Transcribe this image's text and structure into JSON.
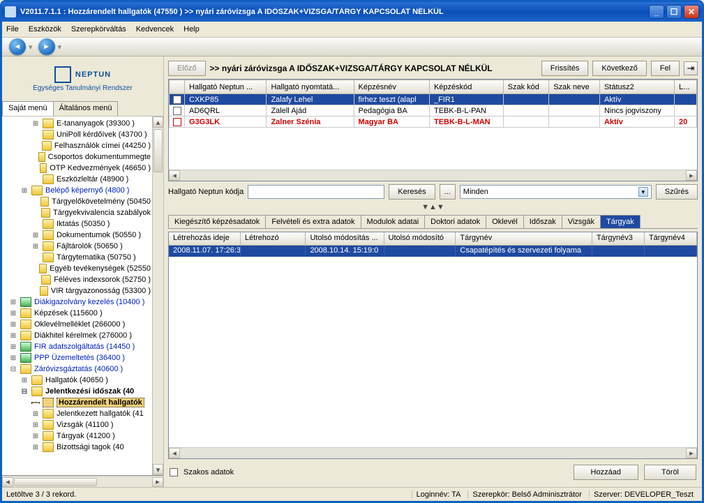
{
  "titlebar": {
    "text": "V2011.7.1.1 : Hozzárendelt hallgatók (47550  )   >> nyári záróvizsga A IDŐSZAK+VIZSGA/TÁRGY KAPCSOLAT NÉLKÜL"
  },
  "menubar": [
    "File",
    "Eszközök",
    "Szerepkörváltás",
    "Kedvencek",
    "Help"
  ],
  "logo": {
    "main": "NEPTUN",
    "sub": "Egységes Tanulmányi Rendszer"
  },
  "side_tabs": [
    "Saját menü",
    "Általános menü"
  ],
  "tree": [
    {
      "ind": 2,
      "tw": "⊞",
      "ico": "yellow",
      "txt": "E-tananyagok (39300  )"
    },
    {
      "ind": 2,
      "tw": "",
      "ico": "yellow",
      "txt": "UniPoll kérdőívek (43700  )"
    },
    {
      "ind": 2,
      "tw": "",
      "ico": "yellow",
      "txt": "Felhasználók címei (44250  )"
    },
    {
      "ind": 2,
      "tw": "",
      "ico": "yellow",
      "txt": "Csoportos dokumentummegte"
    },
    {
      "ind": 2,
      "tw": "",
      "ico": "yellow",
      "txt": "OTP Kedvezmények (46650  )"
    },
    {
      "ind": 2,
      "tw": "",
      "ico": "yellow",
      "txt": "Eszközleltár (48900  )"
    },
    {
      "ind": 1,
      "tw": "⊞",
      "ico": "yellow",
      "txt": "Belépő képernyő (4800  )",
      "cls": "blue-txt"
    },
    {
      "ind": 2,
      "tw": "",
      "ico": "yellow",
      "txt": "Tárgyelőkövetelmény (50450"
    },
    {
      "ind": 2,
      "tw": "",
      "ico": "yellow",
      "txt": "Tárgyekvivalencia szabályok"
    },
    {
      "ind": 2,
      "tw": "",
      "ico": "yellow",
      "txt": "Iktatás (50350  )"
    },
    {
      "ind": 2,
      "tw": "⊞",
      "ico": "yellow",
      "txt": "Dokumentumok (50550  )"
    },
    {
      "ind": 2,
      "tw": "⊞",
      "ico": "yellow",
      "txt": "Fájltárolók (50650  )"
    },
    {
      "ind": 2,
      "tw": "",
      "ico": "yellow",
      "txt": "Tárgytematika (50750  )"
    },
    {
      "ind": 2,
      "tw": "",
      "ico": "yellow",
      "txt": "Egyéb tevékenységek (52550"
    },
    {
      "ind": 2,
      "tw": "",
      "ico": "yellow",
      "txt": "Féléves indexsorok (52750  )"
    },
    {
      "ind": 2,
      "tw": "",
      "ico": "yellow",
      "txt": "VIR tárgyazonosság (53300  )"
    },
    {
      "ind": 0,
      "tw": "⊞",
      "ico": "green",
      "txt": "Diákigazolvány kezelés (10400  )",
      "cls": "blue-txt"
    },
    {
      "ind": 0,
      "tw": "⊞",
      "ico": "yellow",
      "txt": "Képzések (115600  )"
    },
    {
      "ind": 0,
      "tw": "⊞",
      "ico": "yellow",
      "txt": "Oklevélmelléklet (266000  )"
    },
    {
      "ind": 0,
      "tw": "⊞",
      "ico": "yellow",
      "txt": "Diákhitel kérelmek (276000  )"
    },
    {
      "ind": 0,
      "tw": "⊞",
      "ico": "green",
      "txt": "FIR adatszolgáltatás (14450  )",
      "cls": "blue-txt"
    },
    {
      "ind": 0,
      "tw": "⊞",
      "ico": "green",
      "txt": "PPP Üzemeltetés (36400  )",
      "cls": "blue-txt"
    },
    {
      "ind": 0,
      "tw": "⊟",
      "ico": "yellow",
      "txt": "Záróvizsgáztatás (40600  )",
      "cls": "blue-txt"
    },
    {
      "ind": 1,
      "tw": "⊞",
      "ico": "yellow",
      "txt": "Hallgatók (40650  )"
    },
    {
      "ind": 1,
      "tw": "⊟",
      "ico": "yellow",
      "txt": "Jelentkezési időszak (40",
      "cls": "bold"
    },
    {
      "ind": 2,
      "tw": "",
      "ico": "page",
      "txt": "Hozzárendelt hallgatók",
      "cls": "sel bold"
    },
    {
      "ind": 2,
      "tw": "⊞",
      "ico": "yellow",
      "txt": "Jelentkezett hallgatók (41"
    },
    {
      "ind": 2,
      "tw": "⊞",
      "ico": "yellow",
      "txt": "Vizsgák (41100  )"
    },
    {
      "ind": 2,
      "tw": "⊞",
      "ico": "yellow",
      "txt": "Tárgyak (41200  )"
    },
    {
      "ind": 2,
      "tw": "⊞",
      "ico": "yellow",
      "txt": "Bizottsági tagok (40"
    }
  ],
  "top_buttons": {
    "prev": "Előző",
    "refresh": "Frissítés",
    "next": "Következő",
    "up": "Fel"
  },
  "heading": ">> nyári záróvizsga A IDŐSZAK+VIZSGA/TÁRGY KAPCSOLAT NÉLKÜL",
  "grid": {
    "cols": [
      "",
      "Hallgató Neptun ...",
      "Hallgató nyomtatá...",
      "Képzésnév",
      "Képzéskód",
      "Szak kód",
      "Szak neve",
      "Státusz2",
      "L..."
    ],
    "rows": [
      {
        "sel": true,
        "cells": [
          "CXKP85",
          "Zalafy Lehel",
          "firhez teszt (alapl",
          "_FIR1",
          "",
          "",
          "Aktív",
          ""
        ]
      },
      {
        "cells": [
          "AD6QRL",
          "Zalell Ajád",
          "Pedagógia BA",
          "TEBK-B-L-PAN",
          "",
          "",
          "Nincs jogviszony",
          ""
        ]
      },
      {
        "red": true,
        "cells": [
          "G3G3LK",
          "Zalner Szénia",
          "Magyar BA",
          "TEBK-B-L-MAN",
          "",
          "",
          "Aktív",
          "20"
        ]
      }
    ]
  },
  "filter": {
    "label": "Hallgató Neptun kódja",
    "search": "Keresés",
    "browse": "...",
    "dropdown": "Minden",
    "apply": "Szűrés"
  },
  "tabs2": [
    "Kiegészítő képzésadatok",
    "Felvételi és extra adatok",
    "Modulok adatai",
    "Doktori adatok",
    "Oklevél",
    "Időszak",
    "Vizsgák",
    "Tárgyak"
  ],
  "tabs2_active": 7,
  "grid2": {
    "cols": [
      "Létrehozás ideje",
      "Létrehozó",
      "Utolsó módosítás ...",
      "Utolsó módosító",
      "Tárgynév",
      "Tárgynév3",
      "Tárgynév4"
    ],
    "row": [
      "2008.11.07. 17:26:3",
      "",
      "2008.10.14. 15:19:0",
      "",
      "Csapatépítés és szervezeti folyama",
      "",
      ""
    ]
  },
  "check_label": "Szakos adatok",
  "bottom_buttons": {
    "add": "Hozzáad",
    "del": "Töröl"
  },
  "status": {
    "rec": "Letöltve 3 / 3 rekord.",
    "login": "Loginnév: TA",
    "role": "Szerepkör: Belső Adminisztrátor",
    "server": "Szerver: DEVELOPER_Teszt"
  }
}
